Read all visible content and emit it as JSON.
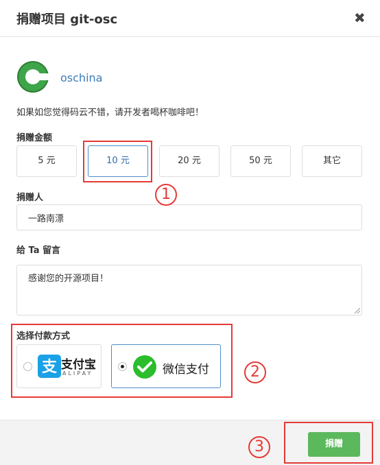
{
  "dialog": {
    "title": "捐赠项目 git-osc",
    "close": "✖"
  },
  "project": {
    "name": "oschina"
  },
  "tip": "如果如您觉得码云不错，请开发者喝杯咖啡吧！",
  "amount": {
    "label": "捐赠金额",
    "options": [
      "5 元",
      "10 元",
      "20 元",
      "50 元",
      "其它"
    ],
    "selected": "10 元"
  },
  "donor": {
    "label": "捐赠人",
    "value": "一路南漂"
  },
  "message": {
    "label": "给 Ta 留言",
    "value": "感谢您的开源项目！"
  },
  "payment": {
    "label": "选择付款方式",
    "alipay": {
      "name": "支付宝",
      "sub": "ALIPAY"
    },
    "wechat": {
      "name": "微信支付"
    },
    "selected": "wechat"
  },
  "footer": {
    "donate_label": "捐赠"
  },
  "annotations": [
    "1",
    "2",
    "3"
  ],
  "colors": {
    "accent": "#4a8cc9",
    "donate": "#5cb85c",
    "highlight": "#e53935",
    "alipay": "#1ba1e6",
    "wechat": "#2bbd2b",
    "logo": "#3fa54a"
  }
}
